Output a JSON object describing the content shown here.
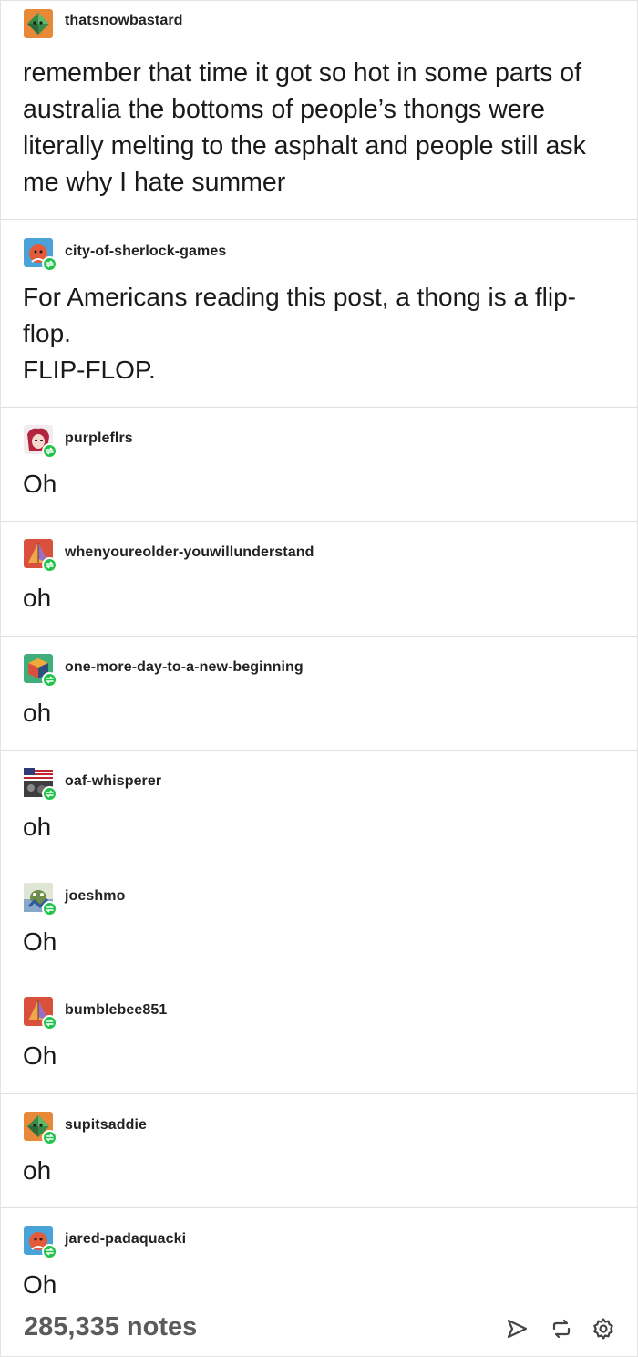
{
  "posts": [
    {
      "username": "thatsnowbastard",
      "text": "remember that time it got so hot in some parts of australia the bottoms of people’s thongs were literally melting to the asphalt and people still ask me why I hate summer",
      "avatar": "orange-diamond-avatar",
      "reblog": false
    },
    {
      "username": "city-of-sherlock-games",
      "text": "For Americans reading this post, a thong is a flip-flop.\nFLIP-FLOP.",
      "avatar": "blue-face-avatar",
      "reblog": true
    },
    {
      "username": "purpleflrs",
      "text": "Oh",
      "avatar": "anime-character-avatar",
      "reblog": true
    },
    {
      "username": "whenyoureolder-youwillunderstand",
      "text": "oh",
      "avatar": "red-pyramid-avatar",
      "reblog": true
    },
    {
      "username": "one-more-day-to-a-new-beginning",
      "text": "oh",
      "avatar": "green-cube-avatar",
      "reblog": true
    },
    {
      "username": "oaf-whisperer",
      "text": "oh",
      "avatar": "flag-photo-avatar",
      "reblog": true
    },
    {
      "username": "joeshmo",
      "text": "Oh",
      "avatar": "cartoon-character-avatar",
      "reblog": true
    },
    {
      "username": "bumblebee851",
      "text": "Oh",
      "avatar": "red-pyramid-avatar",
      "reblog": true
    },
    {
      "username": "supitsaddie",
      "text": "oh",
      "avatar": "orange-diamond-avatar",
      "reblog": true
    },
    {
      "username": "jared-padaquacki",
      "text": "Oh",
      "avatar": "blue-face-avatar",
      "reblog": true
    }
  ],
  "footer": {
    "notes": "285,335 notes",
    "actions": [
      "share-icon",
      "reblog-icon",
      "settings-icon"
    ]
  },
  "colors": {
    "reblog_badge": "#20c44a",
    "notes_text": "#5b5b5b",
    "divider": "#e0e0e0"
  }
}
